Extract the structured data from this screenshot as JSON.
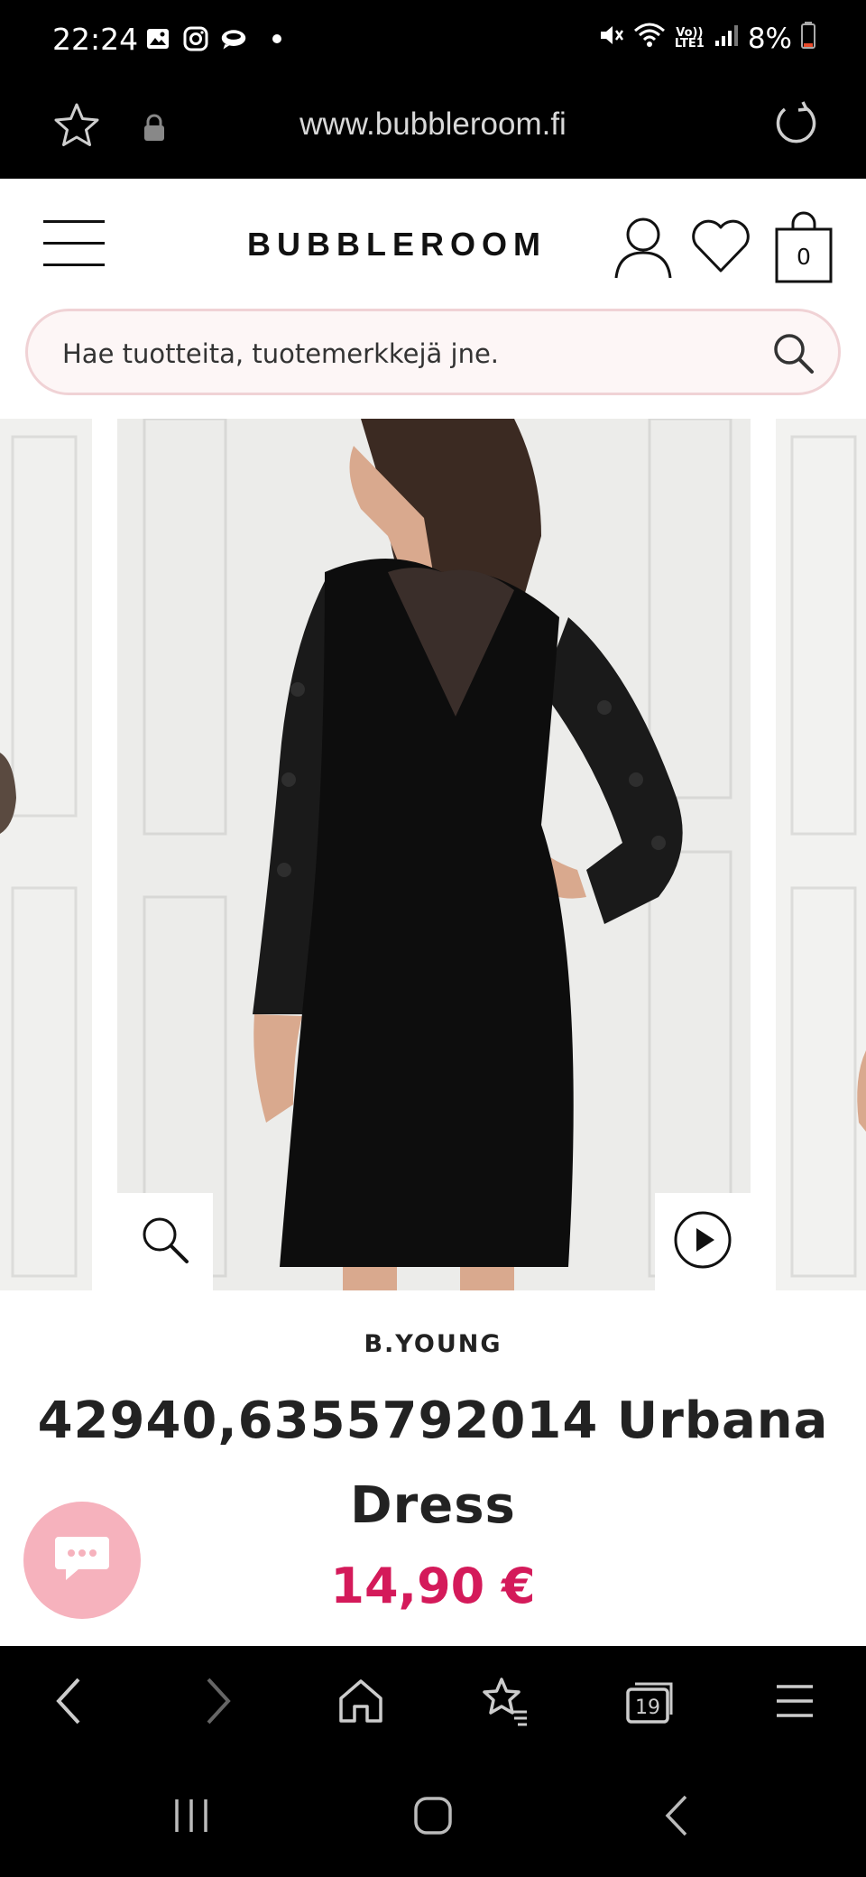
{
  "status_bar": {
    "time": "22:24",
    "battery": "8%",
    "volte_top": "Vo))",
    "volte_bottom": "LTE1",
    "icons": [
      "gallery-icon",
      "instagram-icon",
      "messenger-icon",
      "mute-icon",
      "wifi-icon",
      "signal-icon",
      "battery-icon"
    ]
  },
  "browser": {
    "url": "www.bubbleroom.fi",
    "tab_count": "19"
  },
  "site": {
    "logo": "BUBBLEROOM",
    "cart_count": "0",
    "search_placeholder": "Hae tuotteita, tuotemerkkejä jne."
  },
  "product": {
    "brand": "B.YOUNG",
    "title": "42940,6355792014 Urbana Dress",
    "price": "14,90 €"
  },
  "colors": {
    "price": "#d41a5a",
    "chat_button": "#f6b2bd",
    "search_border": "#f0d2d5"
  }
}
